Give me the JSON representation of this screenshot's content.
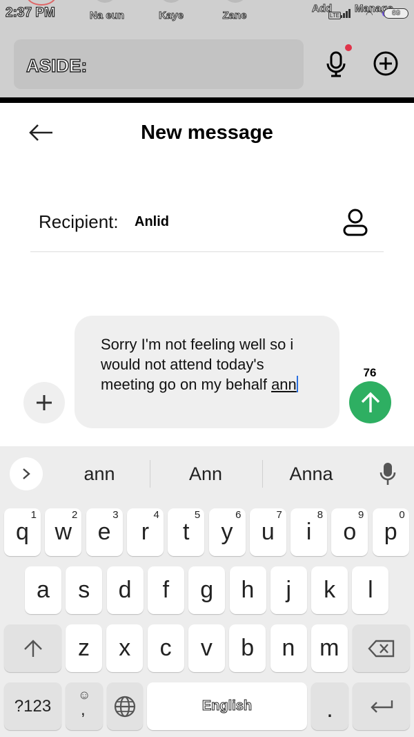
{
  "status_bar": {
    "time": "2:37 PM",
    "contacts": [
      "Na eun",
      "Kaye",
      "Zane"
    ],
    "add_label": "Add",
    "network": "LTE",
    "manage_label": "Manage",
    "battery": "69"
  },
  "aside": {
    "input_text": "ASIDE:",
    "accent_dot_color": "#e0344a"
  },
  "header": {
    "title": "New message"
  },
  "recipient": {
    "label": "Recipient:",
    "value": "Anlid"
  },
  "compose": {
    "message_main": "Sorry I'm not feeling well so i would not attend today's meeting go on my behalf",
    "message_current_word": "ann",
    "char_count": "76",
    "send_color": "#2eaf62"
  },
  "keyboard": {
    "suggestions": [
      "ann",
      "Ann",
      "Anna"
    ],
    "row1": [
      {
        "k": "q",
        "h": "1"
      },
      {
        "k": "w",
        "h": "2"
      },
      {
        "k": "e",
        "h": "3"
      },
      {
        "k": "r",
        "h": "4"
      },
      {
        "k": "t",
        "h": "5"
      },
      {
        "k": "y",
        "h": "6"
      },
      {
        "k": "u",
        "h": "7"
      },
      {
        "k": "i",
        "h": "8"
      },
      {
        "k": "o",
        "h": "9"
      },
      {
        "k": "p",
        "h": "0"
      }
    ],
    "row2": [
      "a",
      "s",
      "d",
      "f",
      "g",
      "h",
      "j",
      "k",
      "l"
    ],
    "row3": [
      "z",
      "x",
      "c",
      "v",
      "b",
      "n",
      "m"
    ],
    "symbols_label": "?123",
    "comma_label": ",",
    "space_label": "English",
    "period_label": "."
  }
}
